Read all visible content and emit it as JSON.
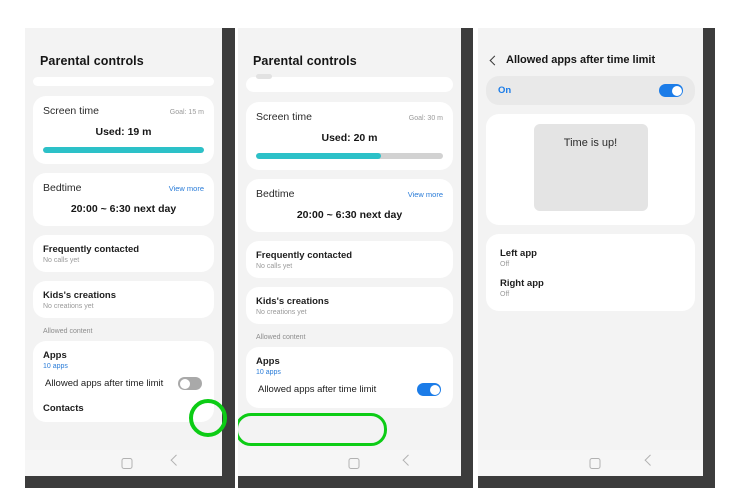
{
  "annotations": {
    "highlight_color": "#0ccc15",
    "accent_blue": "#1b7ce8",
    "link_blue": "#2a7cd8",
    "progress_teal": "#2cc1c8"
  },
  "panel1": {
    "app_title": "Parental controls",
    "screen_time": {
      "title": "Screen time",
      "goal": "Goal: 15 m",
      "used": "Used: 19 m",
      "progress_percent": 100
    },
    "bedtime": {
      "title": "Bedtime",
      "view_more": "View more",
      "value": "20:00 ~ 6:30 next day"
    },
    "frequently_contacted": {
      "title": "Frequently contacted",
      "subtitle": "No calls yet"
    },
    "kids_creations": {
      "title": "Kids's creations",
      "subtitle": "No creations yet"
    },
    "allowed_content_header": "Allowed content",
    "apps": {
      "title": "Apps",
      "subtitle": "10 apps"
    },
    "allowed_apps_after_time_limit": {
      "label": "Allowed apps after time limit",
      "toggle_state": "off"
    },
    "contacts": {
      "title": "Contacts"
    },
    "navbar": {
      "home": "home-square",
      "back": "back-chevron"
    }
  },
  "panel2": {
    "app_title": "Parental controls",
    "screen_time": {
      "title": "Screen time",
      "goal": "Goal: 30 m",
      "used": "Used: 20 m",
      "progress_percent": 67
    },
    "bedtime": {
      "title": "Bedtime",
      "view_more": "View more",
      "value": "20:00 ~ 6:30 next day"
    },
    "frequently_contacted": {
      "title": "Frequently contacted",
      "subtitle": "No calls yet"
    },
    "kids_creations": {
      "title": "Kids's creations",
      "subtitle": "No creations yet"
    },
    "allowed_content_header": "Allowed content",
    "apps": {
      "title": "Apps",
      "subtitle": "10 apps"
    },
    "allowed_apps_after_time_limit": {
      "label": "Allowed apps after time limit",
      "toggle_state": "on"
    },
    "navbar": {
      "home": "home-square",
      "back": "back-chevron"
    }
  },
  "panel3": {
    "title": "Allowed apps after time limit",
    "back": "back-chevron",
    "toggle_row": {
      "label": "On",
      "toggle_state": "on"
    },
    "illustration": {
      "text": "Time is up!"
    },
    "apps": [
      {
        "title": "Left app",
        "status": "Off"
      },
      {
        "title": "Right app",
        "status": "Off"
      }
    ],
    "navbar": {
      "home": "home-square",
      "back": "back-chevron"
    }
  }
}
